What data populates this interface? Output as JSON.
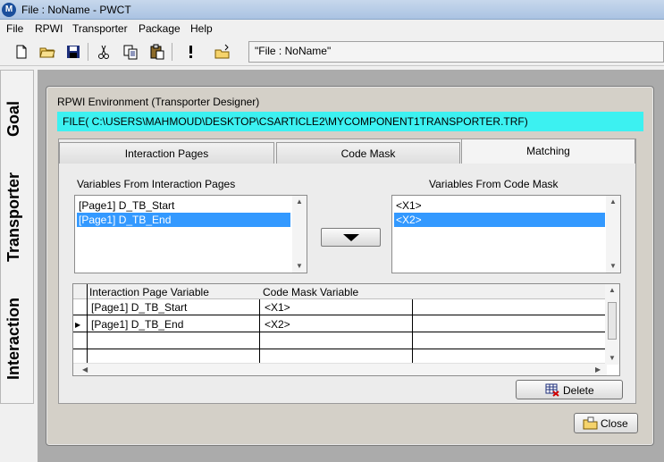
{
  "window": {
    "title": "File : NoName - PWCT",
    "logo_letter": "M"
  },
  "menu": [
    "File",
    "RPWI",
    "Transporter",
    "Package",
    "Help"
  ],
  "toolbar": {
    "icons": [
      "new-file-icon",
      "open-folder-icon",
      "save-icon",
      "cut-icon",
      "copy-icon",
      "paste-icon",
      "run-icon",
      "open-project-icon"
    ],
    "status_text": "\"File : NoName\""
  },
  "sidebar_tabs": [
    "Goal",
    "Transporter",
    "Interaction"
  ],
  "dialog": {
    "title": "RPWI Environment (Transporter Designer)",
    "file_path": "FILE( C:\\USERS\\MAHMOUD\\DESKTOP\\CSARTICLE2\\MYCOMPONENT1TRANSPORTER.TRF)",
    "tabs": [
      "Interaction Pages",
      "Code Mask",
      "Matching"
    ],
    "active_tab": "Matching",
    "left_list": {
      "label": "Variables From Interaction Pages",
      "items": [
        "[Page1] D_TB_Start",
        "[Page1] D_TB_End"
      ],
      "selected": "[Page1] D_TB_End"
    },
    "right_list": {
      "label": "Variables From Code Mask",
      "items": [
        "<X1>",
        "<X2>"
      ],
      "selected": "<X2>"
    },
    "grid": {
      "headers": [
        "Interaction Page Variable",
        "Code Mask Variable"
      ],
      "rows": [
        [
          "[Page1] D_TB_Start",
          "<X1>"
        ],
        [
          "[Page1] D_TB_End",
          "<X2>"
        ]
      ]
    },
    "delete_label": "Delete",
    "close_label": "Close"
  }
}
